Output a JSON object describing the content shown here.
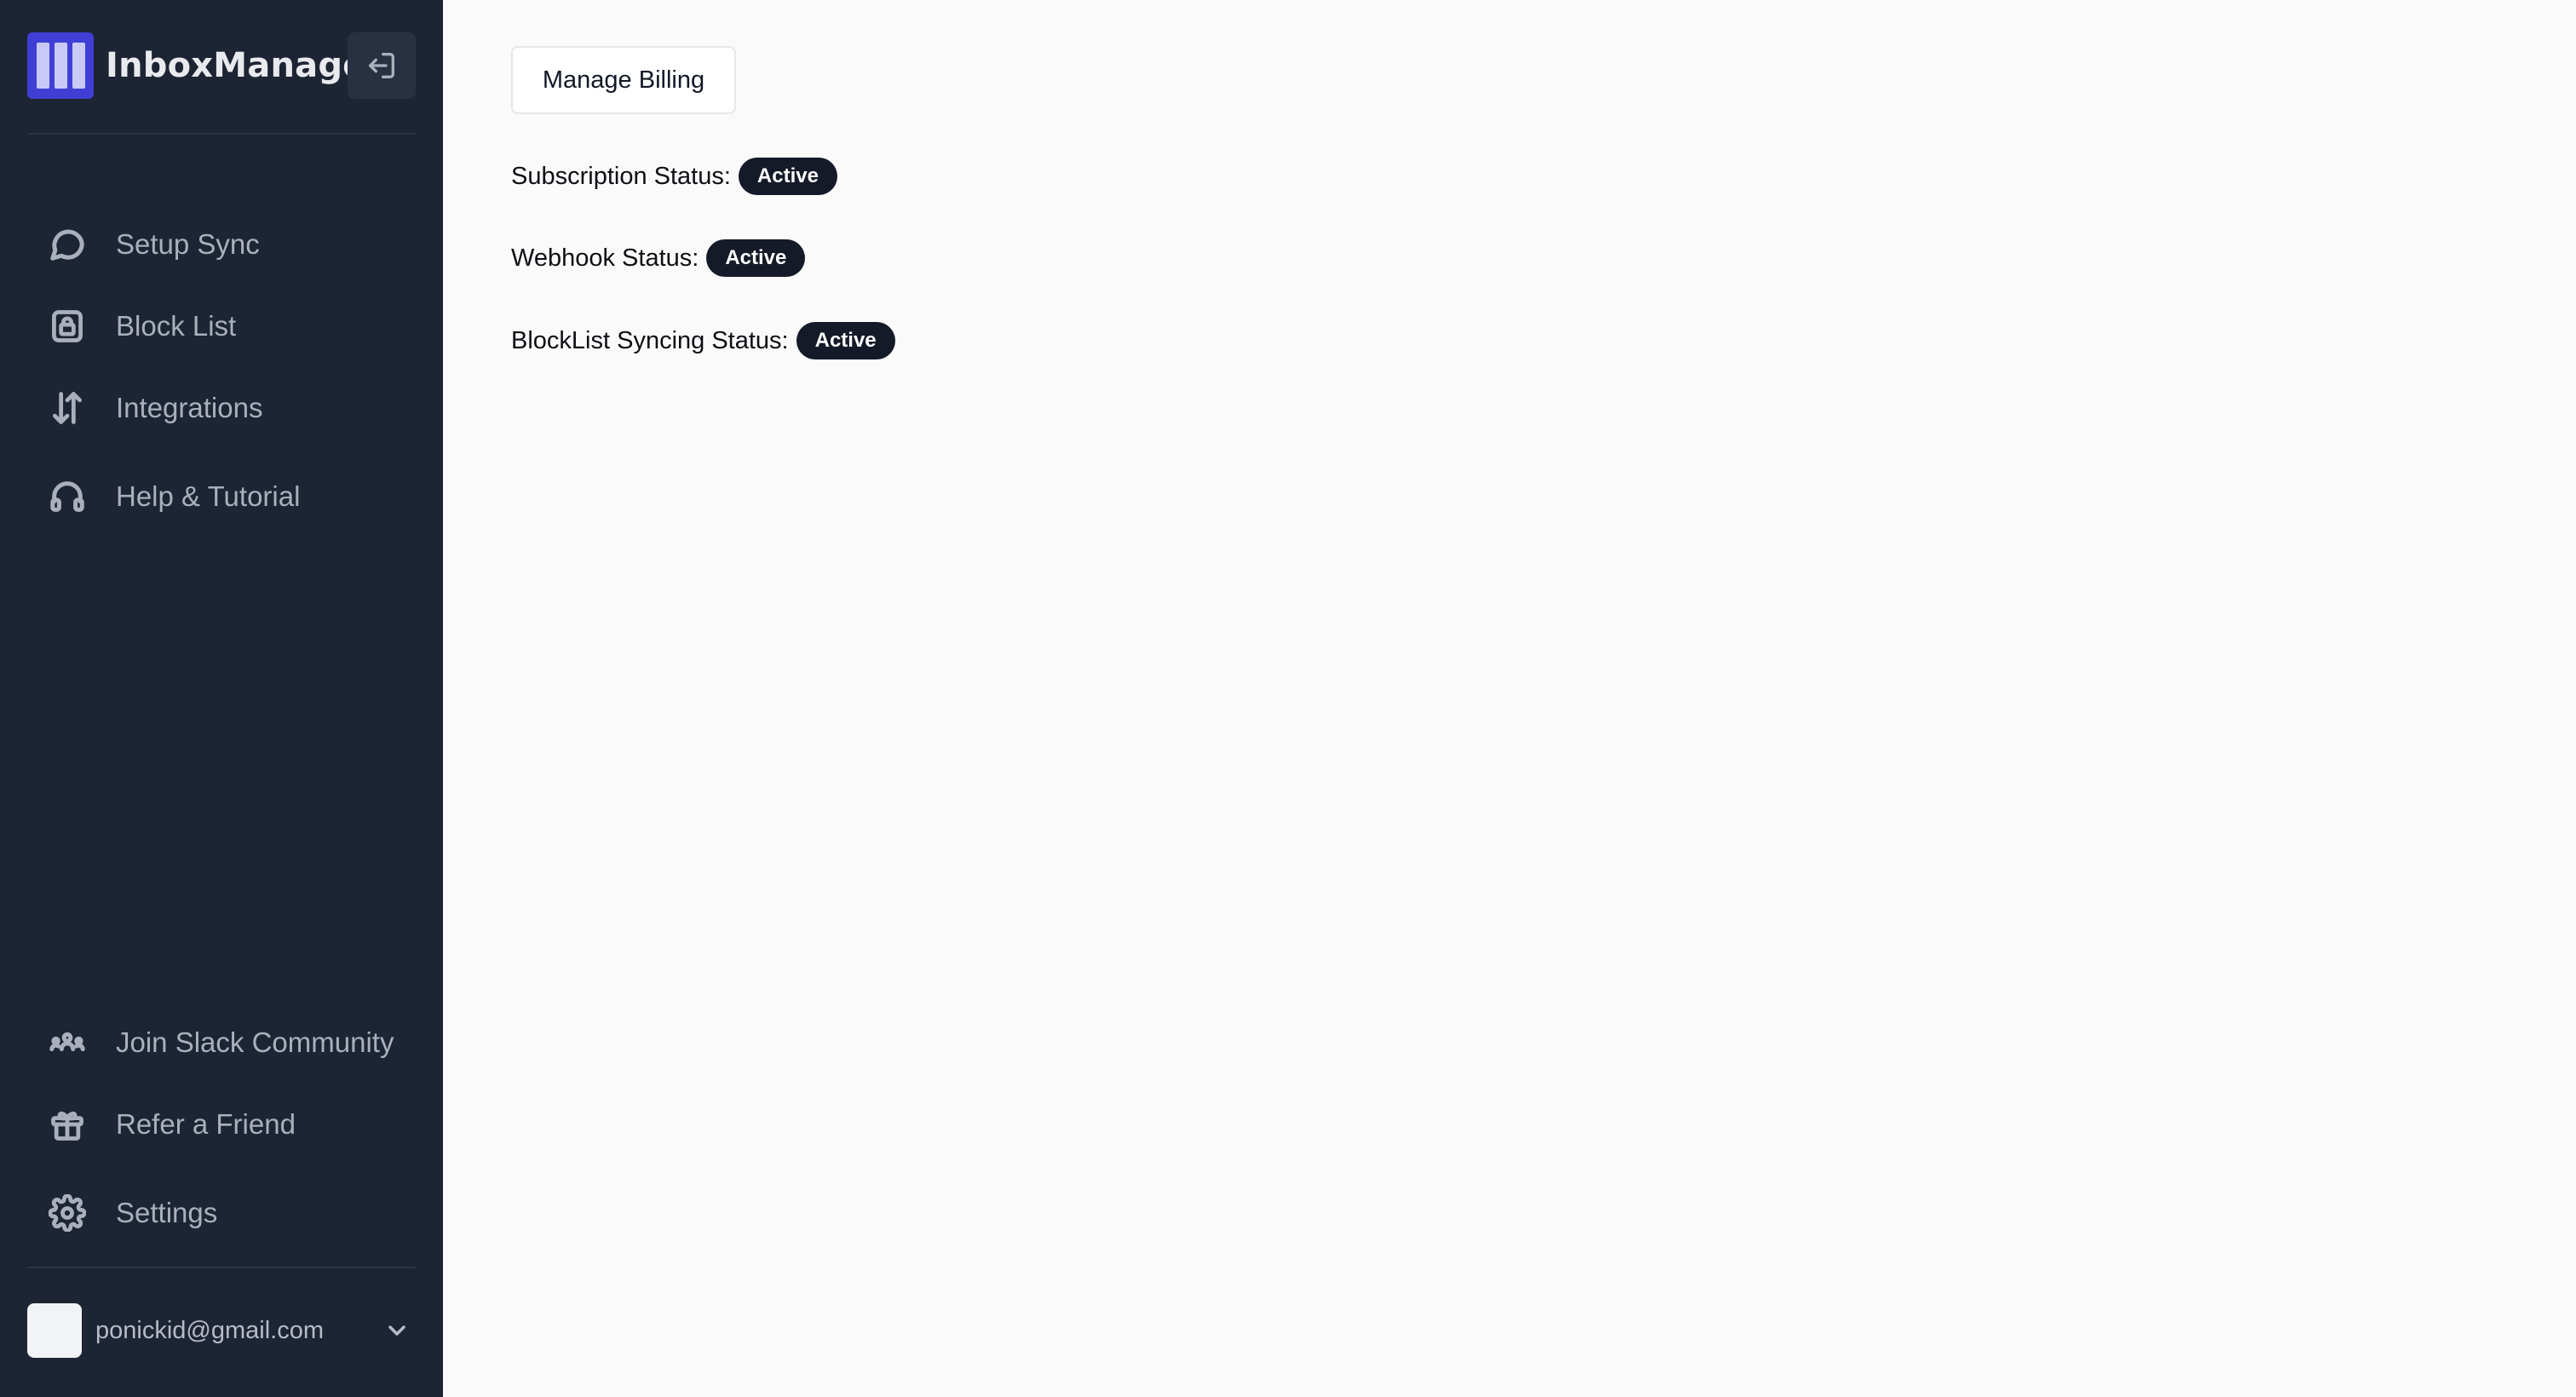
{
  "sidebar": {
    "brand_name": "InboxManager",
    "nav_items": [
      {
        "label": "Setup Sync",
        "icon": "chat-bubble-icon"
      },
      {
        "label": "Block List",
        "icon": "lock-icon"
      },
      {
        "label": "Integrations",
        "icon": "arrows-up-down-icon"
      },
      {
        "label": "Help & Tutorial",
        "icon": "headset-icon"
      }
    ],
    "bottom_items": [
      {
        "label": "Join Slack Community",
        "icon": "community-icon"
      },
      {
        "label": "Refer a Friend",
        "icon": "gift-icon"
      },
      {
        "label": "Settings",
        "icon": "gear-icon"
      }
    ],
    "user_email": "ponickid@gmail.com"
  },
  "main": {
    "manage_billing_label": "Manage Billing",
    "statuses": [
      {
        "label": "Subscription Status:",
        "value": "Active"
      },
      {
        "label": "Webhook Status:",
        "value": "Active"
      },
      {
        "label": "BlockList Syncing Status:",
        "value": "Active"
      }
    ]
  },
  "colors": {
    "sidebar_bg": "#1d2433",
    "brand_accent": "#3f3fd6",
    "badge_bg": "#141a28",
    "main_bg": "#fafafa"
  }
}
